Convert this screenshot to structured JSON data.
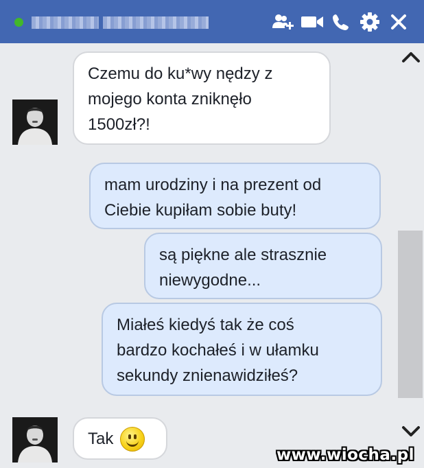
{
  "header": {
    "status": "online",
    "icons": [
      "add-friend-icon",
      "video-call-icon",
      "phone-icon",
      "gear-icon",
      "close-icon"
    ]
  },
  "messages": [
    {
      "direction": "incoming",
      "text": "Czemu do ku*wy nędzy z\nmojego konta zniknęło\n1500zł?!"
    },
    {
      "direction": "outgoing",
      "text": "mam urodziny i na prezent od\nCiebie kupiłam sobie buty!"
    },
    {
      "direction": "outgoing",
      "text": "są piękne ale strasznie\nniewygodne..."
    },
    {
      "direction": "outgoing",
      "text": "Miałeś kiedyś tak że coś\nbardzo kochałeś i w ułamku\nsekundy znienawidziłeś?"
    },
    {
      "direction": "incoming",
      "text": "Tak",
      "emoji": "smiley-icon"
    }
  ],
  "watermark": "www.wiocha.pl",
  "colors": {
    "header_bg": "#4267b2",
    "chat_bg": "#e9ebee",
    "incoming_bubble": "#ffffff",
    "outgoing_bubble": "#ddeafd",
    "online": "#42b72a"
  }
}
